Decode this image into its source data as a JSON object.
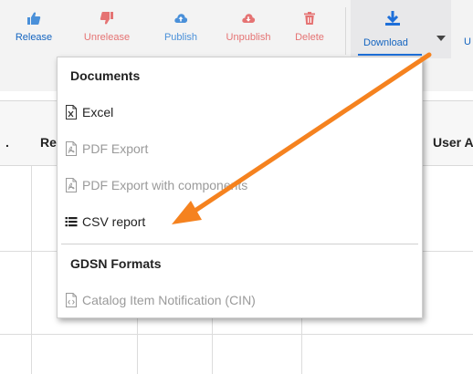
{
  "colors": {
    "toolbar_bg": "#f3f3f3",
    "link_blue": "#1565c0",
    "danger_red": "#e57373",
    "action_blue": "#4a90d9",
    "annotation_orange": "#f5821f"
  },
  "toolbar": {
    "buttons": [
      {
        "label": "Release",
        "icon": "thumbs-up-icon"
      },
      {
        "label": "Unrelease",
        "icon": "thumbs-down-icon"
      },
      {
        "label": "Publish",
        "icon": "cloud-upload-icon"
      },
      {
        "label": "Unpublish",
        "icon": "cloud-download-icon"
      },
      {
        "label": "Delete",
        "icon": "trash-icon"
      },
      {
        "label": "Download",
        "icon": "download-icon"
      }
    ],
    "cut_label": "U"
  },
  "table": {
    "headers": [
      ".",
      "Re",
      "User A"
    ]
  },
  "menu": {
    "sections": [
      {
        "title": "Documents",
        "items": [
          {
            "label": "Excel",
            "icon": "excel-file-icon",
            "enabled": true
          },
          {
            "label": "PDF Export",
            "icon": "pdf-file-icon",
            "enabled": false
          },
          {
            "label": "PDF Export with components",
            "icon": "pdf-file-icon",
            "enabled": false
          },
          {
            "label": "CSV report",
            "icon": "list-icon",
            "enabled": true
          }
        ]
      },
      {
        "title": "GDSN Formats",
        "items": [
          {
            "label": "Catalog Item Notification (CIN)",
            "icon": "code-file-icon",
            "enabled": false
          }
        ]
      }
    ]
  }
}
